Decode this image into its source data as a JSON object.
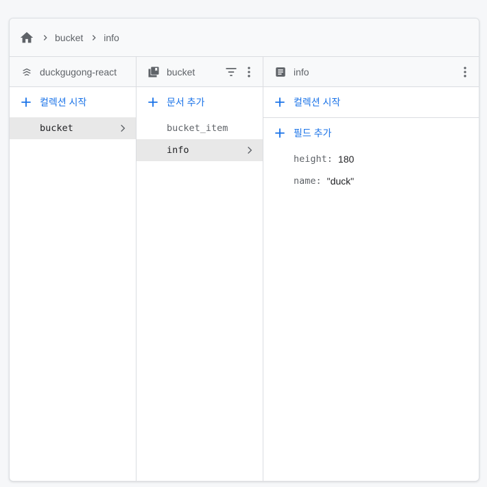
{
  "breadcrumb": {
    "home_icon": "home-icon",
    "items": [
      "bucket",
      "info"
    ]
  },
  "columns": {
    "project": {
      "title": "duckgugong-react",
      "icon": "firestore-project-icon",
      "add_label": "컬렉션 시작",
      "items": [
        {
          "label": "bucket",
          "selected": true
        }
      ]
    },
    "collection": {
      "title": "bucket",
      "icon": "collection-icon",
      "add_label": "문서 추가",
      "items": [
        {
          "label": "bucket_item",
          "selected": false
        },
        {
          "label": "info",
          "selected": true
        }
      ]
    },
    "document": {
      "title": "info",
      "icon": "document-icon",
      "add_collection_label": "컬렉션 시작",
      "add_field_label": "필드 추가",
      "fields": [
        {
          "key": "height:",
          "value": "180"
        },
        {
          "key": "name:",
          "value": "\"duck\""
        }
      ]
    }
  },
  "colors": {
    "accent": "#1a73e8",
    "header_bg": "#f8f9fa",
    "selected_bg": "#e8e8e8"
  }
}
